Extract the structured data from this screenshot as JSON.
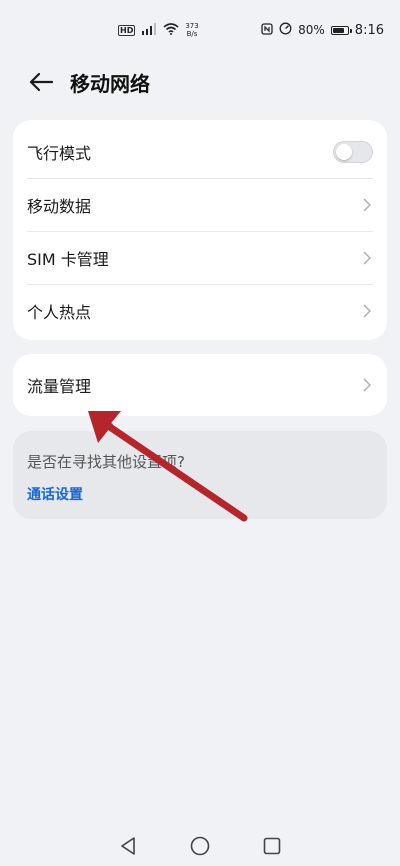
{
  "status_bar": {
    "hd_badge": "HD",
    "net_speed_value": "373",
    "net_speed_unit": "B/s",
    "battery_percent": "80%",
    "battery_level": 0.8,
    "time": "8:16"
  },
  "header": {
    "title": "移动网络"
  },
  "settings_card": {
    "items": [
      {
        "label": "飞行模式",
        "control": "toggle",
        "toggle_on": false
      },
      {
        "label": "移动数据",
        "control": "chevron"
      },
      {
        "label": "SIM 卡管理",
        "control": "chevron"
      },
      {
        "label": "个人热点",
        "control": "chevron"
      }
    ]
  },
  "traffic_card": {
    "label": "流量管理"
  },
  "suggestion": {
    "title": "是否在寻找其他设置项?",
    "link": "通话设置"
  },
  "colors": {
    "background": "#f1f2f5",
    "card": "#ffffff",
    "link": "#1766d4",
    "annotation_arrow": "#b5252c"
  },
  "icons": {
    "back": "arrow-left-icon",
    "chevron": "chevron-right-icon",
    "nav_back": "triangle-back-icon",
    "nav_home": "circle-home-icon",
    "nav_recent": "square-recent-icon"
  }
}
